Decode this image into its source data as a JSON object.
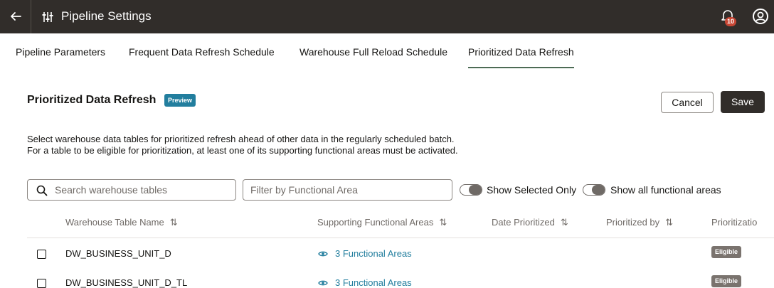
{
  "header": {
    "title": "Pipeline Settings",
    "notification_count": "10"
  },
  "tabs": [
    {
      "label": "Pipeline Parameters"
    },
    {
      "label": "Frequent Data Refresh Schedule"
    },
    {
      "label": "Warehouse Full Reload Schedule"
    },
    {
      "label": "Prioritized Data Refresh",
      "active": true
    }
  ],
  "section": {
    "title": "Prioritized Data Refresh",
    "badge": "Preview",
    "description_line1": "Select warehouse data tables for prioritized refresh ahead of other data in the regularly scheduled batch.",
    "description_line2": "For a table to be eligible for prioritization, at least one of its supporting functional areas must be activated."
  },
  "actions": {
    "cancel_label": "Cancel",
    "save_label": "Save"
  },
  "filters": {
    "search_placeholder": "Search warehouse tables",
    "search_value": "",
    "functional_area_placeholder": "Filter by Functional Area",
    "functional_area_value": "",
    "show_selected_label": "Show Selected Only",
    "show_all_label": "Show all functional areas"
  },
  "table": {
    "columns": [
      {
        "label": "Warehouse Table Name",
        "sortable": true
      },
      {
        "label": "Supporting Functional Areas",
        "sortable": true
      },
      {
        "label": "Date Prioritized",
        "sortable": true
      },
      {
        "label": "Prioritized by",
        "sortable": true
      },
      {
        "label": "Prioritizatio",
        "sortable": false
      }
    ],
    "sort_glyph": "⇅",
    "rows": [
      {
        "name": "DW_BUSINESS_UNIT_D",
        "areas": "3 Functional Areas",
        "date": "",
        "by": "",
        "status": "Eligible"
      },
      {
        "name": "DW_BUSINESS_UNIT_D_TL",
        "areas": "3 Functional Areas",
        "date": "",
        "by": "",
        "status": "Eligible"
      }
    ]
  },
  "icons": {
    "back": "arrow-left-icon",
    "settings": "sliders-icon",
    "notifications": "bell-icon",
    "user": "user-avatar-icon",
    "search": "search-icon",
    "view": "eye-icon"
  },
  "colors": {
    "topbar": "#312d2a",
    "link": "#227e9e",
    "preview_badge": "#227e9e",
    "eligible_badge": "#7a736e",
    "notification_badge": "#c74634",
    "active_tab_underline": "#4d6b55"
  }
}
